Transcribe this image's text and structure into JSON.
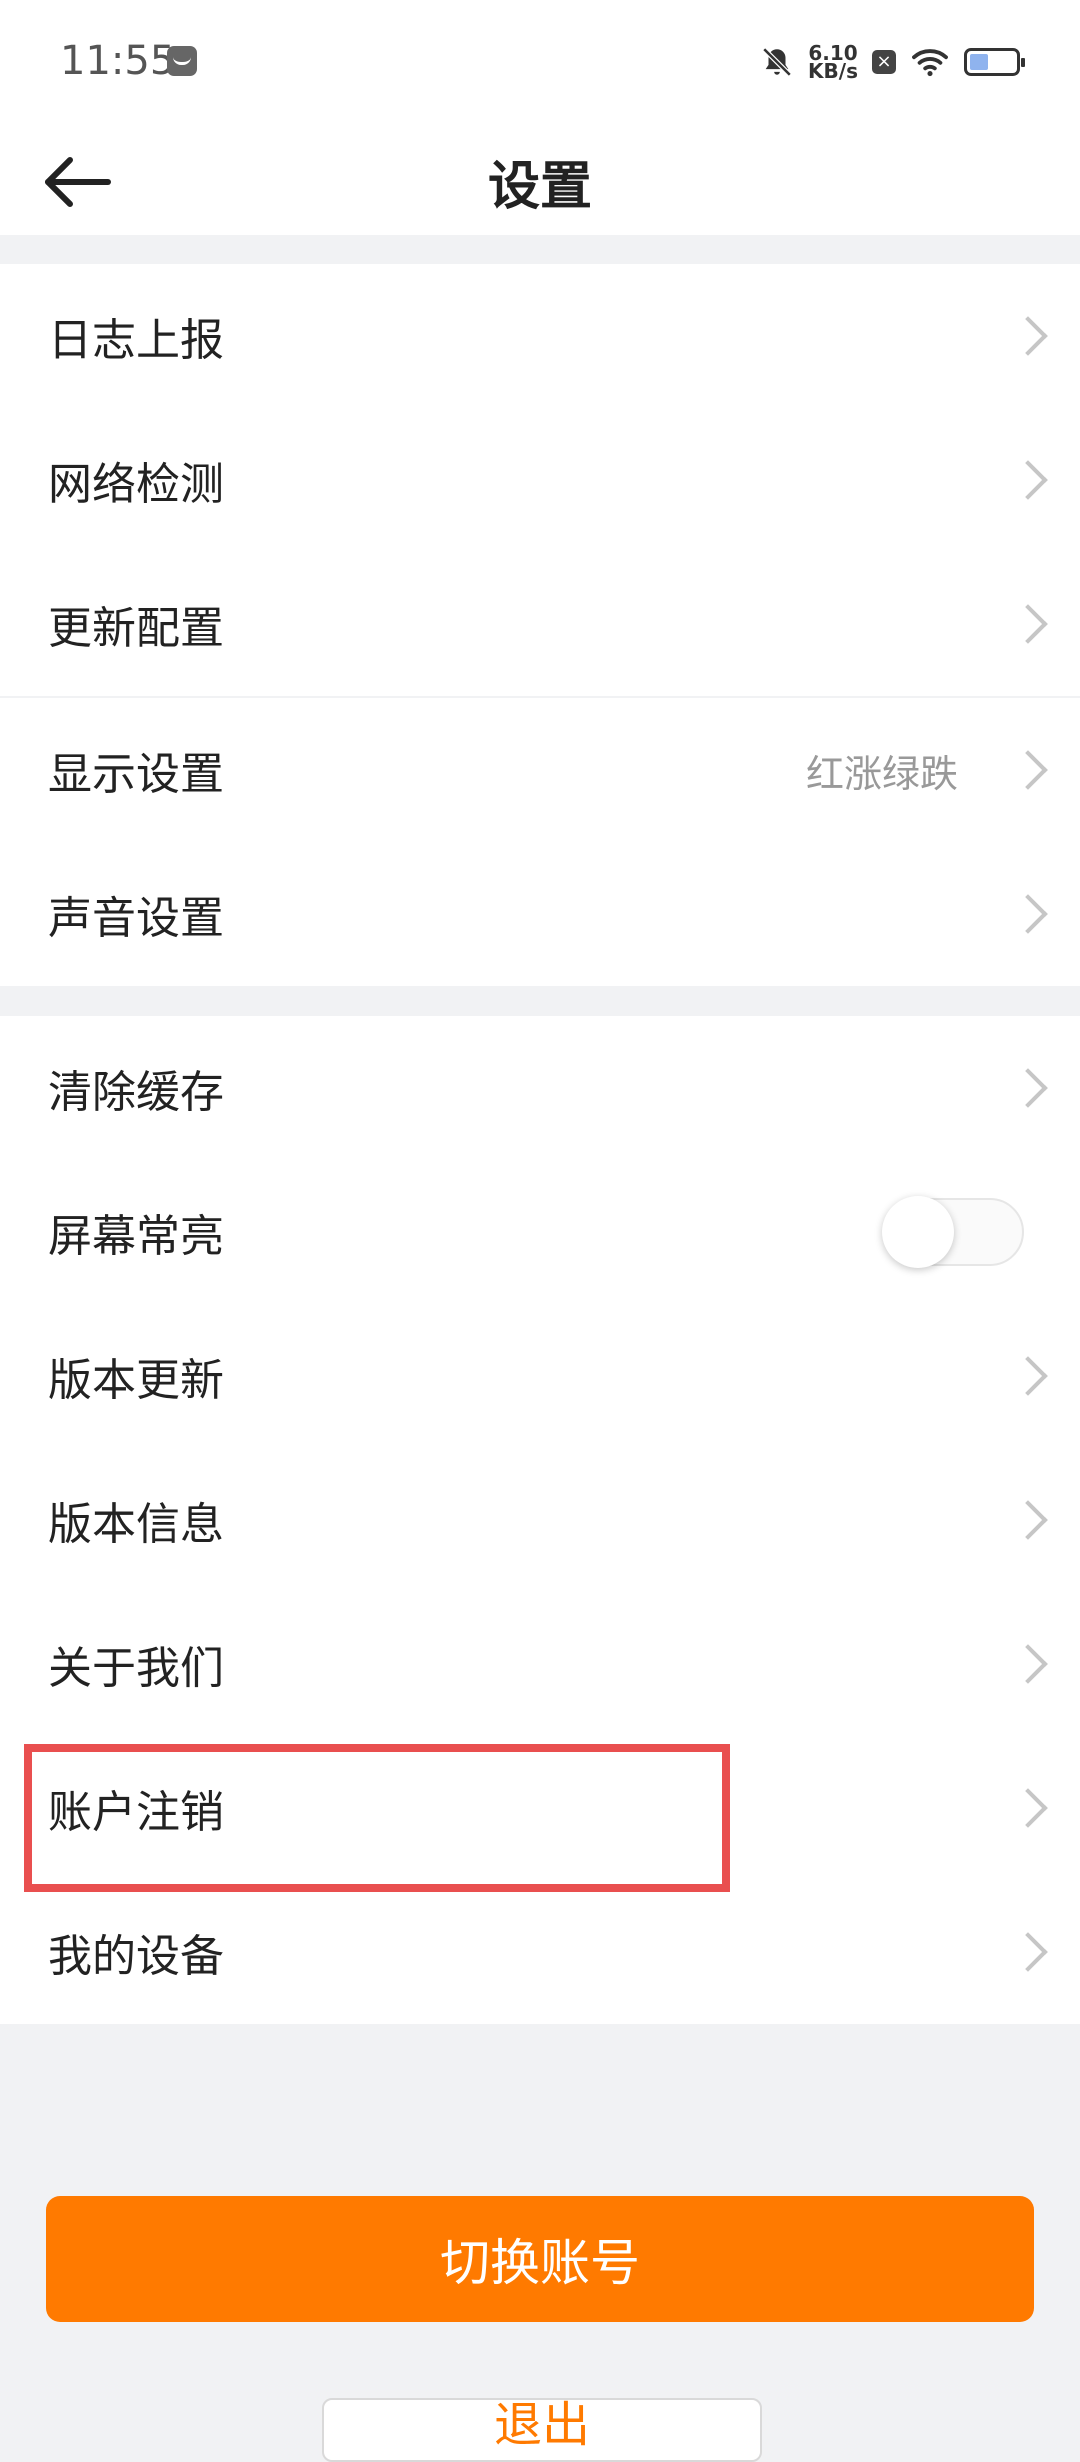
{
  "status_bar": {
    "time": "11:55",
    "speed_value": "6.10",
    "speed_unit": "KB/s",
    "box_glyph": "×",
    "battery_level": 0.4
  },
  "nav": {
    "title": "设置"
  },
  "sections": [
    {
      "items": [
        {
          "label": "日志上报",
          "value": "",
          "control": "chevron"
        },
        {
          "label": "网络检测",
          "value": "",
          "control": "chevron"
        },
        {
          "label": "更新配置",
          "value": "",
          "control": "chevron"
        }
      ]
    },
    {
      "items": [
        {
          "label": "显示设置",
          "value": "红涨绿跌",
          "control": "chevron"
        },
        {
          "label": "声音设置",
          "value": "",
          "control": "chevron"
        }
      ]
    },
    {
      "items": [
        {
          "label": "清除缓存",
          "value": "",
          "control": "chevron"
        },
        {
          "label": "屏幕常亮",
          "value": "",
          "control": "toggle",
          "on": false
        },
        {
          "label": "版本更新",
          "value": "",
          "control": "chevron"
        },
        {
          "label": "版本信息",
          "value": "",
          "control": "chevron"
        },
        {
          "label": "关于我们",
          "value": "",
          "control": "chevron"
        },
        {
          "label": "账户注销",
          "value": "",
          "control": "chevron"
        },
        {
          "label": "我的设备",
          "value": "",
          "control": "chevron"
        }
      ]
    }
  ],
  "buttons": {
    "switch_account": "切换账号",
    "logout": "退出"
  },
  "colors": {
    "accent": "#ff7a00",
    "highlight": "#e94f4f",
    "background": "#f1f2f4"
  },
  "icons": {
    "back": "arrow-left-icon",
    "chevron": "chevron-right-icon",
    "mute": "bell-off-icon",
    "wifi": "wifi-icon",
    "battery": "battery-icon"
  }
}
